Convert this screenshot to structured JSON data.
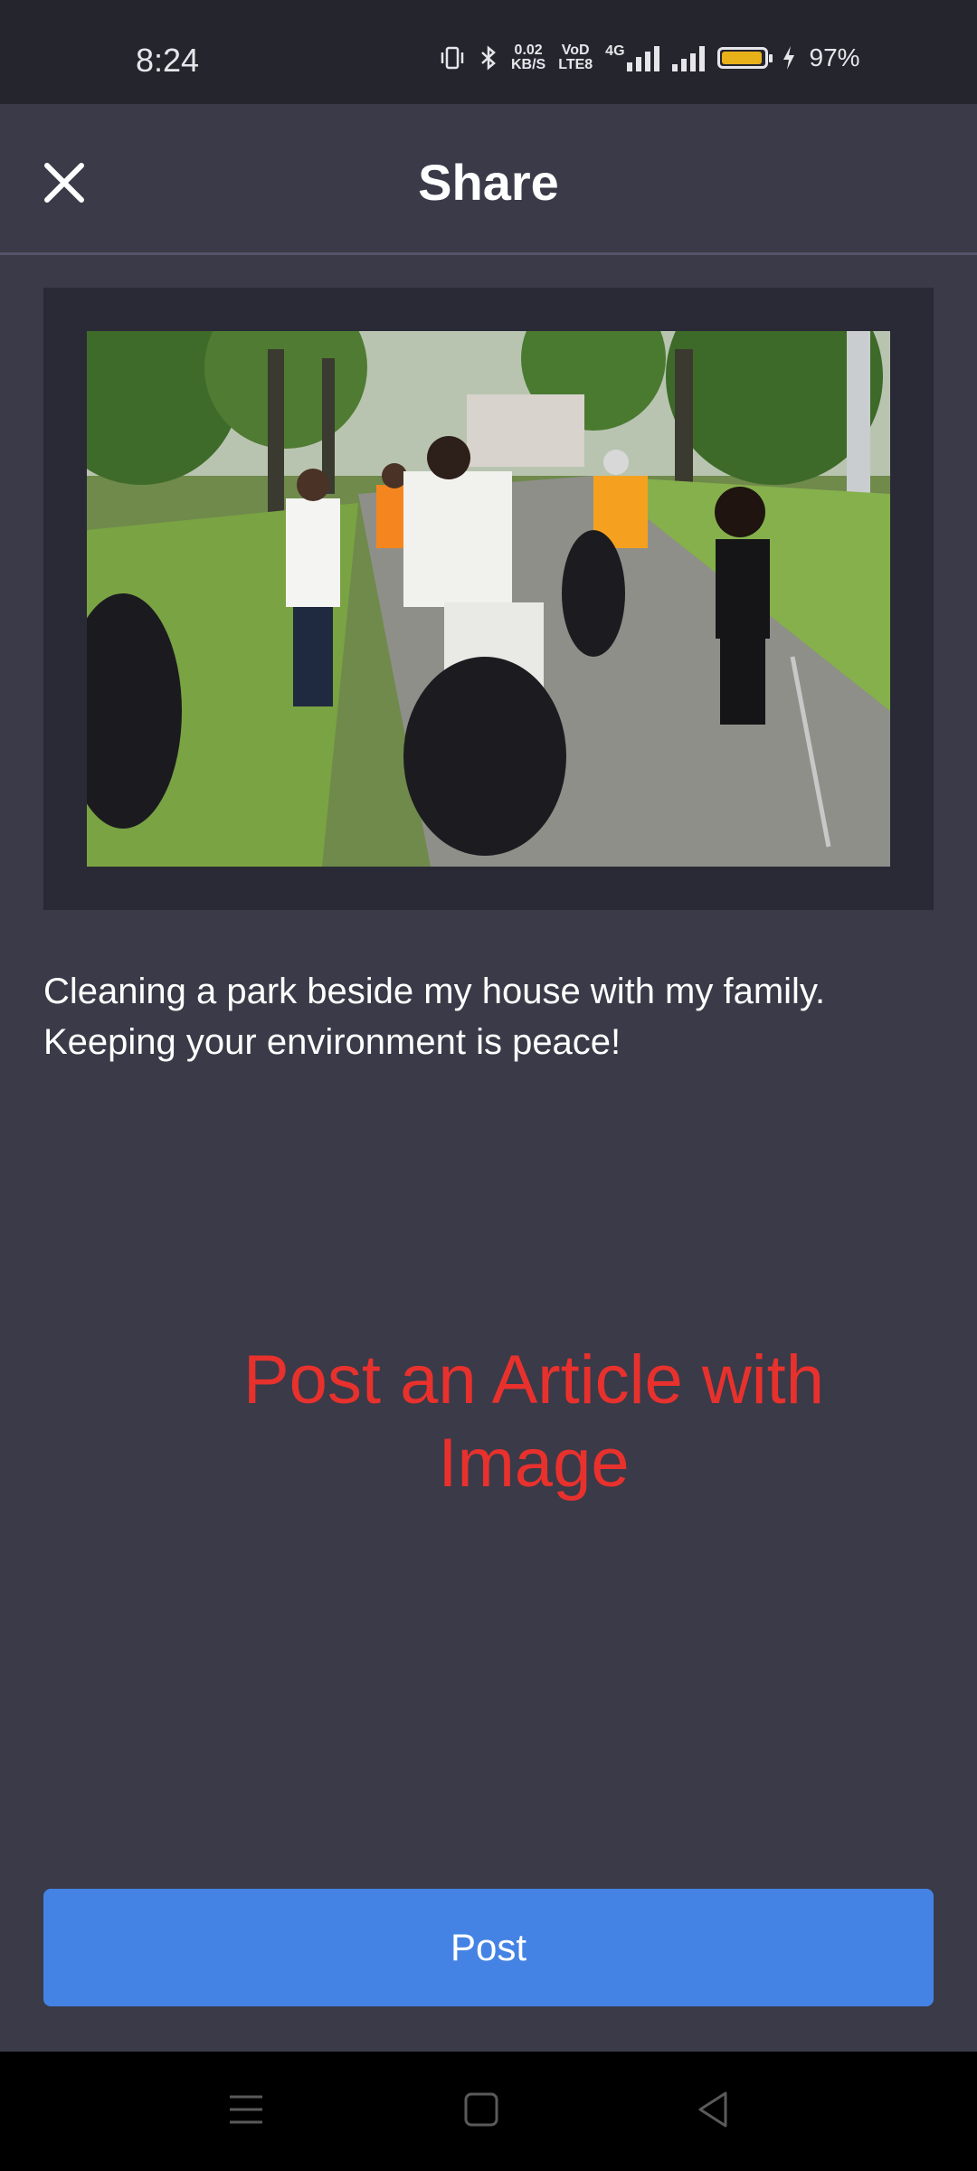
{
  "status_bar": {
    "time": "8:24",
    "net_speed_top": "0.02",
    "net_speed_bottom": "KB/S",
    "volte_top": "VoD",
    "volte_bottom": "LTE8",
    "network": "4G",
    "battery_percent": "97%",
    "battery_level": 0.97,
    "battery_color": "#e8b019",
    "icons": [
      "vibrate-icon",
      "bluetooth-icon",
      "signal-icon",
      "battery-icon",
      "charging-icon"
    ]
  },
  "header": {
    "title": "Share",
    "close_icon": "close-icon"
  },
  "post": {
    "image_alt": "People cleaning a park with trash bags",
    "caption": "Cleaning a park beside my house with my family. Keeping your environment is peace!"
  },
  "overlay": {
    "text": "Post an Article with Image",
    "color": "#e8312d"
  },
  "actions": {
    "post_label": "Post",
    "post_color": "#4483e4"
  },
  "nav_bar": {
    "items": [
      "menu-icon",
      "home-icon",
      "back-icon"
    ]
  }
}
